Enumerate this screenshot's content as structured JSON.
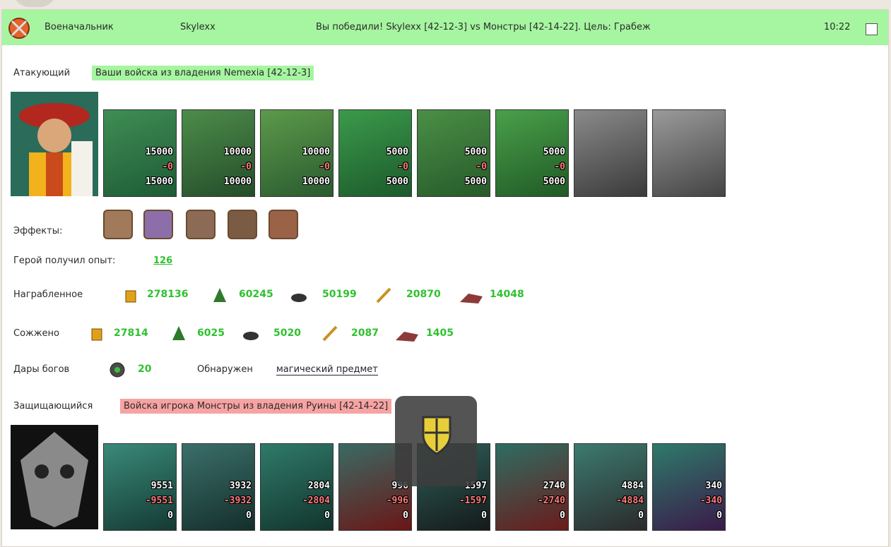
{
  "header": {
    "role": "Военачальник",
    "player": "Skylexx",
    "result": "Вы победили! Skylexx [42-12-3] vs Монстры [42-14-22]. Цель: Грабеж",
    "time": "10:22"
  },
  "attacker": {
    "label": "Атакующий",
    "origin": "Ваши войска из владения Nemexia [42-12-3]",
    "units": [
      {
        "top": "15000",
        "mid": "-0",
        "bot": "15000"
      },
      {
        "top": "10000",
        "mid": "-0",
        "bot": "10000"
      },
      {
        "top": "10000",
        "mid": "-0",
        "bot": "10000"
      },
      {
        "top": "5000",
        "mid": "-0",
        "bot": "5000"
      },
      {
        "top": "5000",
        "mid": "-0",
        "bot": "5000"
      },
      {
        "top": "5000",
        "mid": "-0",
        "bot": "5000"
      },
      {
        "top": "",
        "mid": "",
        "bot": ""
      },
      {
        "top": "",
        "mid": "",
        "bot": ""
      }
    ]
  },
  "effects": {
    "label": "Эффекты:"
  },
  "experience": {
    "label": "Герой получил опыт:",
    "value": "126"
  },
  "plundered": {
    "label": "Награбленное",
    "gold": "278136",
    "wood": "60245",
    "stone": "50199",
    "grain": "20870",
    "iron": "14048"
  },
  "burned": {
    "label": "Сожжено",
    "gold": "27814",
    "wood": "6025",
    "stone": "5020",
    "grain": "2087",
    "iron": "1405"
  },
  "gifts": {
    "label": "Дары богов",
    "value": "20",
    "found_label": "Обнаружен",
    "found_value": "магический предмет"
  },
  "defender": {
    "label": "Защищающийся",
    "origin": "Войска игрока Монстры из владения Руины [42-14-22]",
    "units": [
      {
        "top": "9551",
        "mid": "-9551",
        "bot": "0"
      },
      {
        "top": "3932",
        "mid": "-3932",
        "bot": "0"
      },
      {
        "top": "2804",
        "mid": "-2804",
        "bot": "0"
      },
      {
        "top": "996",
        "mid": "-996",
        "bot": "0"
      },
      {
        "top": "1597",
        "mid": "-1597",
        "bot": "0"
      },
      {
        "top": "2740",
        "mid": "-2740",
        "bot": "0"
      },
      {
        "top": "4884",
        "mid": "-4884",
        "bot": "0"
      },
      {
        "top": "340",
        "mid": "-340",
        "bot": "0"
      }
    ]
  },
  "colors": {
    "green": "#a6f5a0",
    "red": "#f7a3a3",
    "value_green": "#2fc12f"
  }
}
